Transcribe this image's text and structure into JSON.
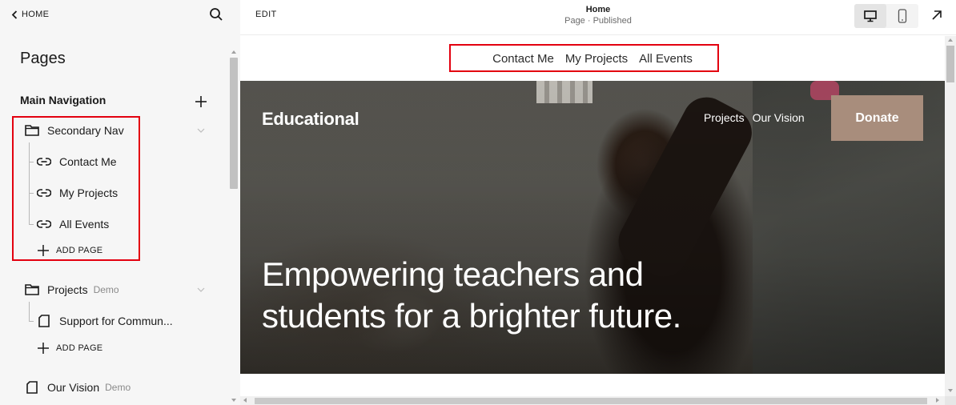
{
  "sidebar": {
    "home_label": "HOME",
    "pages_title": "Pages",
    "section_title": "Main Navigation",
    "secondary_nav": {
      "label": "Secondary Nav",
      "items": [
        {
          "label": "Contact Me",
          "icon": "link-icon"
        },
        {
          "label": "My Projects",
          "icon": "link-icon"
        },
        {
          "label": "All Events",
          "icon": "link-icon"
        }
      ],
      "add_page_label": "ADD PAGE"
    },
    "projects": {
      "label": "Projects",
      "tag": "Demo",
      "items": [
        {
          "label": "Support for Commun...",
          "icon": "page-icon"
        }
      ],
      "add_page_label": "ADD PAGE"
    },
    "our_vision": {
      "label": "Our Vision",
      "tag": "Demo"
    }
  },
  "topbar": {
    "edit_label": "EDIT",
    "page_name": "Home",
    "page_status": "Page · Published",
    "views": [
      "desktop-icon",
      "mobile-icon"
    ],
    "active_view": "desktop"
  },
  "preview": {
    "secondary_nav": [
      "Contact Me",
      "My Projects",
      "All Events"
    ],
    "brand": "Educational",
    "hero_nav": [
      "Projects",
      "Our Vision"
    ],
    "donate_label": "Donate",
    "headline_line1": "Empowering teachers and",
    "headline_line2": "students for a brighter future."
  },
  "colors": {
    "highlight": "#e3000f",
    "donate_bg": "#a88d7c",
    "sidebar_bg": "#f6f6f6"
  }
}
